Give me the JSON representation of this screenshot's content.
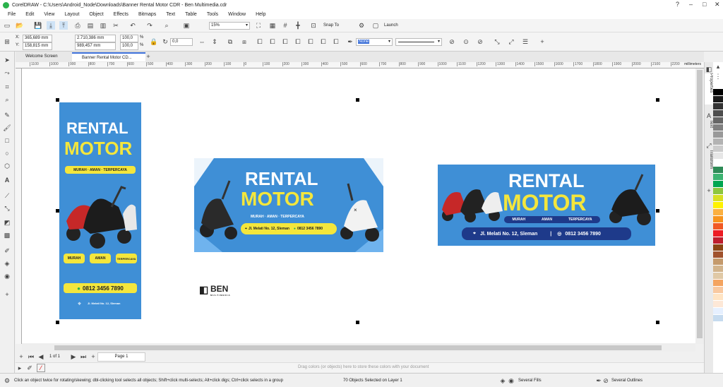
{
  "window": {
    "title": "CorelDRAW - C:\\Users\\Android_Node\\Downloads\\Banner Rental Motor CDR - Ben Multimedia.cdr"
  },
  "menu": [
    "File",
    "Edit",
    "View",
    "Layout",
    "Object",
    "Effects",
    "Bitmaps",
    "Text",
    "Table",
    "Tools",
    "Window",
    "Help"
  ],
  "toolbar": {
    "zoom": "15%",
    "snap": "Snap To",
    "launch": "Launch"
  },
  "props": {
    "x": "365,689 mm",
    "y": "158,815 mm",
    "w": "2.710,386 mm",
    "h": "989,457 mm",
    "sx": "100,0",
    "sy": "100,0",
    "pct": "%",
    "angle": "0,0",
    "outline": "None"
  },
  "tabs": {
    "welcome": "Welcome Screen",
    "doc": "Banner Rental Motor CD..."
  },
  "ruler": {
    "unit": "millimeters",
    "ticks": [
      "1100",
      "1000",
      "900",
      "800",
      "700",
      "600",
      "500",
      "400",
      "300",
      "200",
      "100",
      "0",
      "100",
      "200",
      "300",
      "400",
      "500",
      "600",
      "700",
      "800",
      "900",
      "1000",
      "1100",
      "1200",
      "1300",
      "1400",
      "1500",
      "1600",
      "1700",
      "1800",
      "1900",
      "2000",
      "2100",
      "2200"
    ]
  },
  "banners": {
    "rental": "RENTAL",
    "motor": "MOTOR",
    "tag": "MURAH · AMAN · TERPERCAYA",
    "murah": "MURAH",
    "aman": "AMAN",
    "terpercaya": "TERPERCAYA",
    "phone": "0812 3456 7890",
    "address": "Jl. Melati No. 12, Sleman"
  },
  "logo": {
    "text": "BEN",
    "sub": "MULTIMEDIA"
  },
  "pagebar": {
    "pageinfo": "1 of 1",
    "page": "Page 1"
  },
  "colorbar": {
    "hint": "Drag colors (or objects) here to store these colors with your document"
  },
  "status": {
    "hint": "Click an object twice for rotating/skewing; dbl-clicking tool selects all objects; Shift+click multi-selects; Alt+click digs; Ctrl+click selects in a group",
    "selected": "70 Objects Selected on Layer 1",
    "fills": "Several Fills",
    "outlines": "Several Outlines"
  },
  "dockers": [
    "Properties",
    "Text",
    "Transform"
  ],
  "palette": [
    "#ffffff",
    "#000000",
    "#1a1a1a",
    "#333333",
    "#4d4d4d",
    "#666666",
    "#808080",
    "#999999",
    "#b3b3b3",
    "#cccccc",
    "#e6e6e6",
    "#ffffff",
    "#2e8b57",
    "#3cb371",
    "#00a651",
    "#8dc63f",
    "#d7df23",
    "#fff200",
    "#fbb040",
    "#f7941d",
    "#f15a24",
    "#ed1c24",
    "#be1e2d",
    "#8b4513",
    "#a0522d",
    "#c49a6c",
    "#d2b48c",
    "#e0c9a6",
    "#f4a460",
    "#f9c9a0",
    "#ffe4c4",
    "#fde8d7",
    "#e6f0ff",
    "#c6dbef"
  ],
  "colors": {
    "blue": "#3f8fd6",
    "yellow": "#f4e63c",
    "navy": "#1e3a8a"
  }
}
